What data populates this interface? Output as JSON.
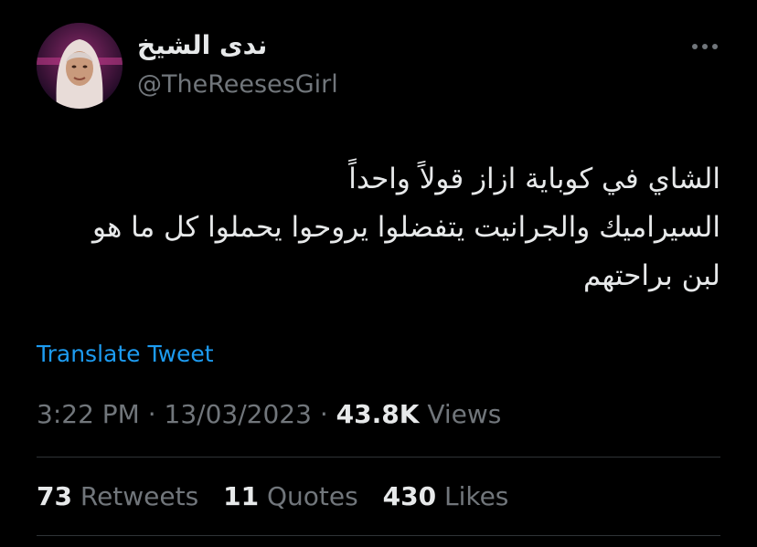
{
  "author": {
    "display_name": "ندى الشيخ",
    "handle": "@TheReesesGirl",
    "avatar_icon": "user-avatar"
  },
  "tweet": {
    "lines": [
      "الشاي في كوباية ازاز قولاً واحداً",
      "السيراميك والجرانيت يتفضلوا يروحوا يحملوا كل ما هو",
      "لبن براحتهم"
    ]
  },
  "translate_label": "Translate Tweet",
  "meta": {
    "time": "3:22 PM",
    "separator": "·",
    "date": "13/03/2023",
    "views_count": "43.8K",
    "views_label": "Views"
  },
  "stats": {
    "retweets_count": "73",
    "retweets_label": "Retweets",
    "quotes_count": "11",
    "quotes_label": "Quotes",
    "likes_count": "430",
    "likes_label": "Likes"
  },
  "colors": {
    "background": "#000000",
    "text": "#e7e9ea",
    "secondary": "#71767b",
    "link": "#1d9bf0",
    "divider": "#2f3336"
  }
}
